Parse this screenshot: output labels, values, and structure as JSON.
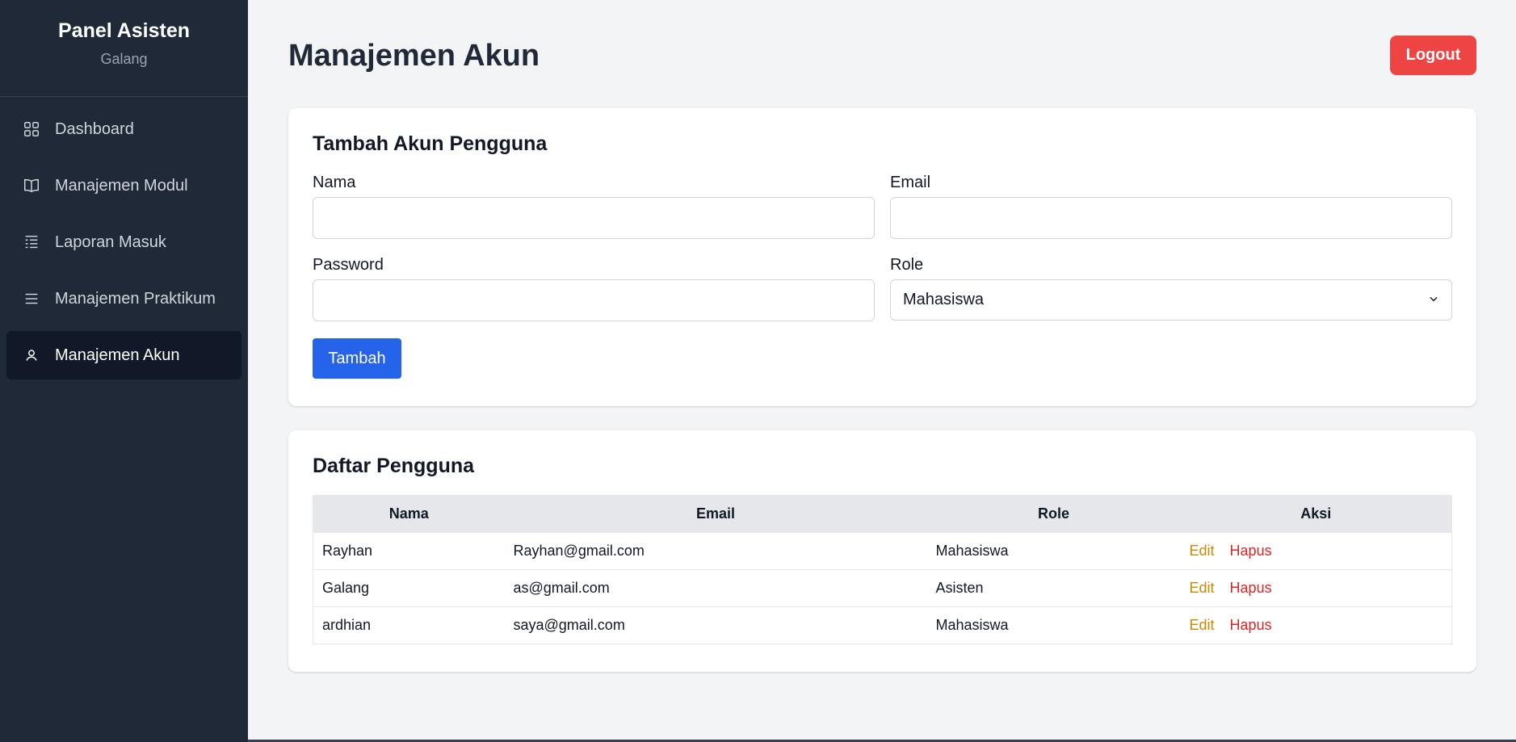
{
  "sidebar": {
    "title": "Panel Asisten",
    "user": "Galang",
    "items": [
      {
        "label": "Dashboard",
        "icon": "grid-icon"
      },
      {
        "label": "Manajemen Modul",
        "icon": "book-icon"
      },
      {
        "label": "Laporan Masuk",
        "icon": "report-icon"
      },
      {
        "label": "Manajemen Praktikum",
        "icon": "menu-icon"
      },
      {
        "label": "Manajemen Akun",
        "icon": "user-icon",
        "active": true
      }
    ]
  },
  "header": {
    "title": "Manajemen Akun",
    "logout_label": "Logout"
  },
  "form": {
    "title": "Tambah Akun Pengguna",
    "nama_label": "Nama",
    "nama_value": "",
    "email_label": "Email",
    "email_value": "",
    "password_label": "Password",
    "password_value": "",
    "role_label": "Role",
    "role_selected": "Mahasiswa",
    "submit_label": "Tambah"
  },
  "list": {
    "title": "Daftar Pengguna",
    "columns": [
      "Nama",
      "Email",
      "Role",
      "Aksi"
    ],
    "rows": [
      {
        "nama": "Rayhan",
        "email": "Rayhan@gmail.com",
        "role": "Mahasiswa",
        "edit": "Edit",
        "hapus": "Hapus"
      },
      {
        "nama": "Galang",
        "email": "as@gmail.com",
        "role": "Asisten",
        "edit": "Edit",
        "hapus": "Hapus"
      },
      {
        "nama": "ardhian",
        "email": "saya@gmail.com",
        "role": "Mahasiswa",
        "edit": "Edit",
        "hapus": "Hapus"
      }
    ]
  },
  "colors": {
    "sidebar_bg": "#1f2937",
    "active_item_bg": "#111827",
    "logout": "#ef4444",
    "primary": "#2563eb",
    "edit": "#ca8a04",
    "delete": "#dc2626"
  }
}
